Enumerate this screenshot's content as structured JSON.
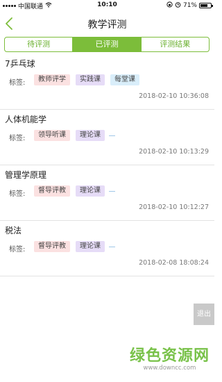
{
  "status_bar": {
    "carrier": "中国联通",
    "time": "10:10",
    "battery": "71%",
    "battery_level": 0.71
  },
  "header": {
    "title": "教学评测"
  },
  "tabs": [
    {
      "label": "待评测"
    },
    {
      "label": "已评测",
      "active": true
    },
    {
      "label": "评测结果"
    }
  ],
  "tag_prefix": "标签:",
  "items": [
    {
      "name": "7乒乓球",
      "tags": [
        {
          "text": "教师评学",
          "color": "red"
        },
        {
          "text": "实践课",
          "color": "purple"
        },
        {
          "text": "每堂课",
          "color": "blue"
        }
      ],
      "time": "2018-02-10 10:36:08"
    },
    {
      "name": "人体机能学",
      "tags": [
        {
          "text": "领导听课",
          "color": "red"
        },
        {
          "text": "理论课",
          "color": "purple"
        }
      ],
      "time": "2018-02-10 10:13:29"
    },
    {
      "name": "管理学原理",
      "tags": [
        {
          "text": "督导评教",
          "color": "red"
        },
        {
          "text": "理论课",
          "color": "purple"
        }
      ],
      "time": "2018-02-10 10:12:27"
    },
    {
      "name": "税法",
      "tags": [
        {
          "text": "督导评教",
          "color": "red"
        },
        {
          "text": "理论课",
          "color": "purple"
        }
      ],
      "time": "2018-02-08 18:08:24"
    }
  ],
  "logout_label": "退出",
  "watermark": {
    "text": "绿色资源网",
    "url": "www.downcc.com"
  },
  "colors": {
    "accent": "#7cbd3a",
    "tag_red": "#fbe1e1",
    "tag_purple": "#e6dcf7",
    "tag_blue": "#d9eefa"
  }
}
